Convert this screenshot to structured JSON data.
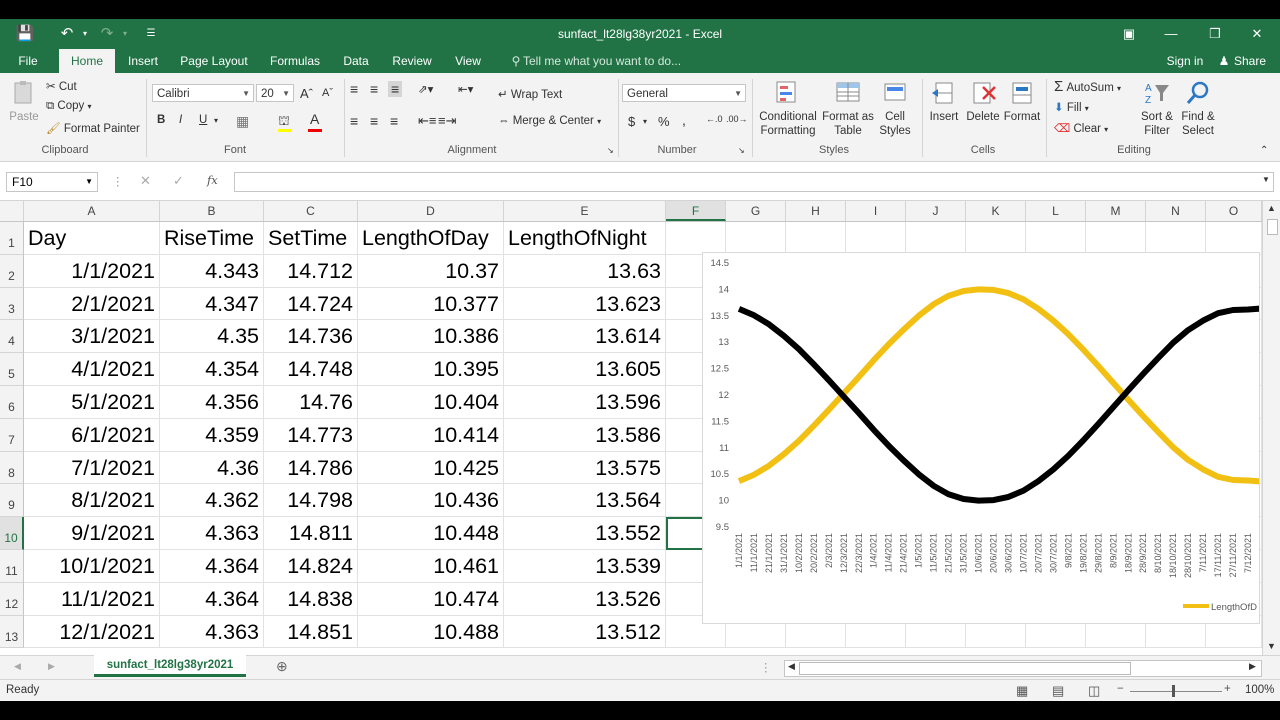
{
  "window": {
    "title": "sunfact_lt28lg38yr2021  -  Excel",
    "signin": "Sign in",
    "share": "Share"
  },
  "tabs": [
    "File",
    "Home",
    "Insert",
    "Page Layout",
    "Formulas",
    "Data",
    "Review",
    "View"
  ],
  "tellme": "Tell me what you want to do...",
  "ribbon": {
    "clipboard": {
      "paste": "Paste",
      "cut": "Cut",
      "copy": "Copy",
      "format_painter": "Format Painter",
      "group": "Clipboard"
    },
    "font": {
      "name": "Calibri",
      "size": "20",
      "bold": "B",
      "italic": "I",
      "underline": "U",
      "group": "Font"
    },
    "alignment": {
      "wrap": "Wrap Text",
      "merge": "Merge & Center",
      "group": "Alignment"
    },
    "number": {
      "format": "General",
      "dollar": "$",
      "percent": "%",
      "comma": ",",
      "group": "Number"
    },
    "styles": {
      "conditional": "Conditional Formatting",
      "format_table": "Format as Table",
      "cell_styles": "Cell Styles",
      "group": "Styles"
    },
    "cells": {
      "insert": "Insert",
      "delete": "Delete",
      "format": "Format",
      "group": "Cells"
    },
    "editing": {
      "autosum": "AutoSum",
      "fill": "Fill",
      "clear": "Clear",
      "sort": "Sort & Filter",
      "find": "Find & Select",
      "group": "Editing"
    }
  },
  "formula_bar": {
    "namebox": "F10",
    "fx": "fx",
    "value": ""
  },
  "columns": [
    "A",
    "B",
    "C",
    "D",
    "E",
    "F",
    "G",
    "H",
    "I",
    "J",
    "K",
    "L",
    "M",
    "N",
    "O"
  ],
  "rows": [
    "1",
    "2",
    "3",
    "4",
    "5",
    "6",
    "7",
    "8",
    "9",
    "10",
    "11",
    "12",
    "13"
  ],
  "table": {
    "headers": [
      "Day",
      "RiseTime",
      "SetTime",
      "LengthOfDay",
      "LengthOfNight"
    ],
    "data": [
      [
        "1/1/2021",
        "4.343",
        "14.712",
        "10.37",
        "13.63"
      ],
      [
        "2/1/2021",
        "4.347",
        "14.724",
        "10.377",
        "13.623"
      ],
      [
        "3/1/2021",
        "4.35",
        "14.736",
        "10.386",
        "13.614"
      ],
      [
        "4/1/2021",
        "4.354",
        "14.748",
        "10.395",
        "13.605"
      ],
      [
        "5/1/2021",
        "4.356",
        "14.76",
        "10.404",
        "13.596"
      ],
      [
        "6/1/2021",
        "4.359",
        "14.773",
        "10.414",
        "13.586"
      ],
      [
        "7/1/2021",
        "4.36",
        "14.786",
        "10.425",
        "13.575"
      ],
      [
        "8/1/2021",
        "4.362",
        "14.798",
        "10.436",
        "13.564"
      ],
      [
        "9/1/2021",
        "4.363",
        "14.811",
        "10.448",
        "13.552"
      ],
      [
        "10/1/2021",
        "4.364",
        "14.824",
        "10.461",
        "13.539"
      ],
      [
        "11/1/2021",
        "4.364",
        "14.838",
        "10.474",
        "13.526"
      ],
      [
        "12/1/2021",
        "4.363",
        "14.851",
        "10.488",
        "13.512"
      ]
    ]
  },
  "chart_data": {
    "type": "line",
    "ylim": [
      9.5,
      14.5
    ],
    "yticks": [
      "14.5",
      "14",
      "13.5",
      "13",
      "12.5",
      "12",
      "11.5",
      "11",
      "10.5",
      "10",
      "9.5"
    ],
    "x_labels": [
      "1/1/2021",
      "11/1/2021",
      "21/1/2021",
      "31/1/2021",
      "10/2/2021",
      "20/2/2021",
      "2/3/2021",
      "12/3/2021",
      "22/3/2021",
      "1/4/2021",
      "11/4/2021",
      "21/4/2021",
      "1/5/2021",
      "11/5/2021",
      "21/5/2021",
      "31/5/2021",
      "10/6/2021",
      "20/6/2021",
      "30/6/2021",
      "10/7/2021",
      "20/7/2021",
      "30/7/2021",
      "9/8/2021",
      "19/8/2021",
      "29/8/2021",
      "8/9/2021",
      "18/9/2021",
      "28/9/2021",
      "8/10/2021",
      "18/10/2021",
      "28/10/2021",
      "7/11/2021",
      "17/11/2021",
      "27/11/2021",
      "7/12/2021",
      "17/12/2021"
    ],
    "series": [
      {
        "name": "LengthOfDay",
        "color": "#f2c012",
        "values": [
          10.37,
          10.49,
          10.66,
          10.88,
          11.13,
          11.42,
          11.72,
          12.03,
          12.34,
          12.66,
          12.96,
          13.24,
          13.5,
          13.72,
          13.88,
          13.97,
          14.0,
          13.99,
          13.93,
          13.81,
          13.63,
          13.41,
          13.15,
          12.86,
          12.55,
          12.23,
          11.91,
          11.6,
          11.3,
          11.01,
          10.77,
          10.59,
          10.45,
          10.39,
          10.38,
          10.36
        ]
      },
      {
        "name": "LengthOfNight",
        "color": "#000000",
        "values": [
          13.63,
          13.51,
          13.34,
          13.12,
          12.87,
          12.58,
          12.28,
          11.97,
          11.66,
          11.34,
          11.04,
          10.76,
          10.5,
          10.28,
          10.12,
          10.03,
          10.0,
          10.01,
          10.07,
          10.19,
          10.37,
          10.59,
          10.85,
          11.14,
          11.45,
          11.77,
          12.09,
          12.4,
          12.7,
          12.99,
          13.23,
          13.41,
          13.55,
          13.61,
          13.62,
          13.64
        ]
      }
    ],
    "legend_label": "LengthOfD"
  },
  "sheet_tab": "sunfact_lt28lg38yr2021",
  "status": {
    "ready": "Ready",
    "zoom": "100%"
  }
}
